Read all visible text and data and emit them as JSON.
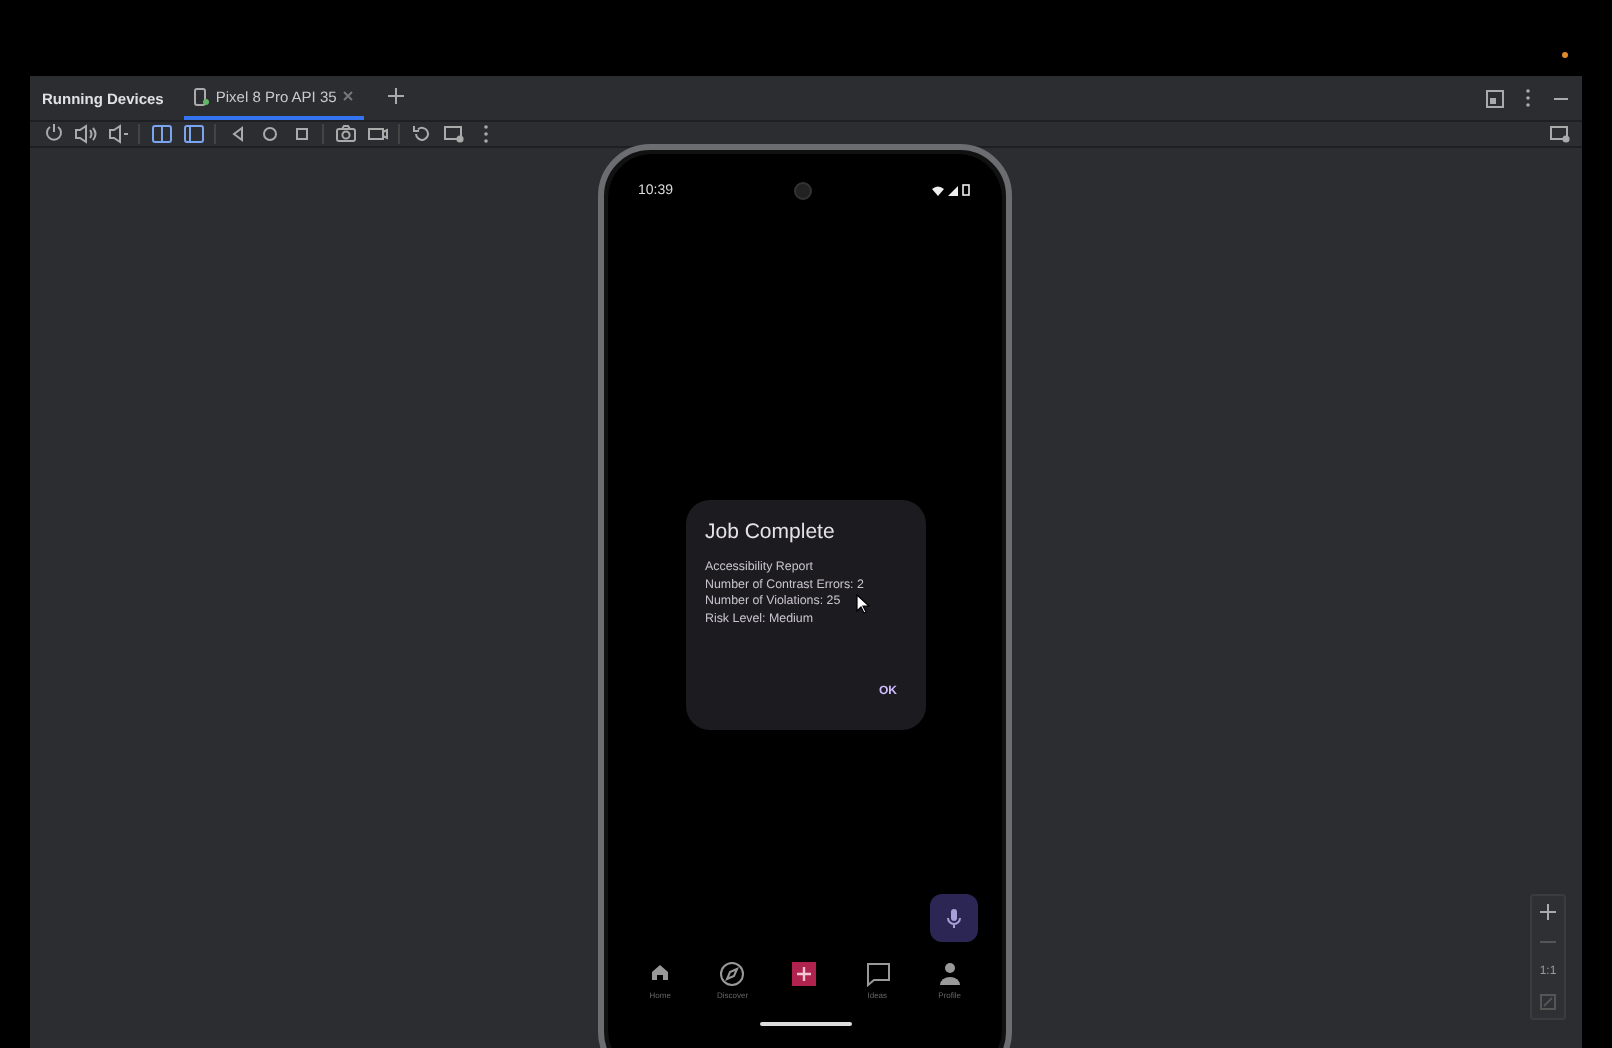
{
  "window": {
    "title": "Running Devices"
  },
  "tabs": [
    {
      "label": "Pixel 8 Pro API 35",
      "selected": true
    }
  ],
  "phone": {
    "status_bar": {
      "time": "10:39"
    },
    "dialog": {
      "title": "Job Complete",
      "lines": [
        "Accessibility Report",
        "Number of Contrast Errors: 2",
        "Number of Violations: 25",
        "Risk Level: Medium"
      ],
      "button": "OK"
    },
    "nav": [
      {
        "kind": "home",
        "label": "Home"
      },
      {
        "kind": "discover",
        "label": "Discover"
      },
      {
        "kind": "add"
      },
      {
        "kind": "ideas",
        "label": "Ideas"
      },
      {
        "kind": "profile",
        "label": "Profile"
      }
    ]
  },
  "zoom_controls": {
    "reset_label": "1:1"
  }
}
